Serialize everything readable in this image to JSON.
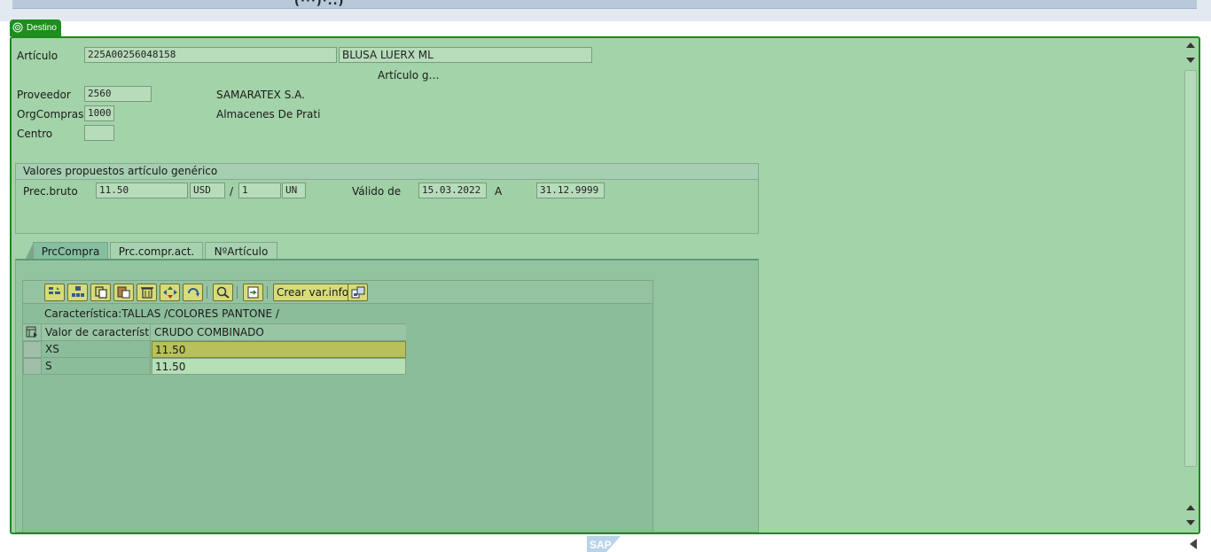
{
  "window": {
    "top_cut_text": "(···)·..)"
  },
  "destination_tab": {
    "label": "Destino"
  },
  "header": {
    "articulo_label": "Artículo",
    "articulo_value": "225A00256048158",
    "articulo_desc": "BLUSA LUERX ML",
    "articulo_type": "Artículo g…",
    "proveedor_label": "Proveedor",
    "proveedor_value": "2560",
    "proveedor_name": "SAMARATEX S.A.",
    "orgcompras_label": "OrgCompras",
    "orgcompras_value": "1000",
    "orgcompras_name": "Almacenes De Prati",
    "centro_label": "Centro",
    "centro_value": ""
  },
  "proposed": {
    "title": "Valores propuestos artículo genérico",
    "prec_bruto_label": "Prec.bruto",
    "prec_bruto_value": "11.50",
    "currency": "USD",
    "per_sep": "/",
    "per_qty": "1",
    "uom": "UN",
    "valid_from_label": "Válido de",
    "valid_from": "15.03.2022",
    "valid_to_label": "A",
    "valid_to": "31.12.9999"
  },
  "tabs": [
    {
      "label": "PrcCompra",
      "active": true
    },
    {
      "label": "Prc.compr.act.",
      "active": false
    },
    {
      "label": "NºArtículo",
      "active": false
    }
  ],
  "matrix": {
    "toolbar": {
      "buttons": [
        "select-all-icon",
        "group-icon",
        "copy-icon",
        "paste-icon",
        "delete-icon",
        "move-icon",
        "refresh-icon",
        "search-icon",
        "export-icon"
      ],
      "create_label": "Crear var.info",
      "last_icon": "variant-info-icon"
    },
    "characteristic_line": "Característica:TALLAS /COLORES PANTONE /",
    "header_col1": "Valor de característica",
    "header_col2": "CRUDO COMBINADO",
    "rows": [
      {
        "key": "XS",
        "value": "11.50",
        "highlight": true
      },
      {
        "key": "S",
        "value": "11.50",
        "highlight": false
      }
    ]
  },
  "footer": {
    "logo_text": "SAP"
  },
  "colors": {
    "panel_bg": "#a3d3a8",
    "panel_border": "#1b8a1b",
    "tab_green": "#1e8e1e",
    "highlight_cell": "#b7c05a"
  }
}
